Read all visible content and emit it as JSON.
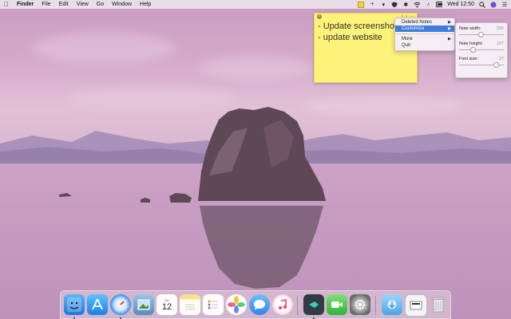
{
  "menubar": {
    "items": [
      "Finder",
      "File",
      "Edit",
      "View",
      "Go",
      "Window",
      "Help"
    ],
    "clock": "Wed 12:50"
  },
  "note": {
    "lines": [
      "- Update screenshots",
      "- update website"
    ]
  },
  "context_menu": {
    "items": [
      {
        "label": "Deleted Notes",
        "submenu": true
      },
      {
        "label": "Customize",
        "submenu": true,
        "selected": true
      },
      {
        "label": "More",
        "submenu": true
      },
      {
        "label": "Quit",
        "submenu": false
      }
    ]
  },
  "customize_panel": {
    "note_width": {
      "label": "Note width:",
      "value": "200",
      "fraction": 0.48
    },
    "note_height": {
      "label": "Note height:",
      "value": "107",
      "fraction": 0.3
    },
    "font_size": {
      "label": "Font size:",
      "value": "27",
      "fraction": 0.82
    }
  },
  "dock": {
    "apps": [
      "finder-icon",
      "app-store-icon",
      "safari-icon",
      "preview-icon",
      "calendar-icon",
      "notes-icon",
      "reminders-icon",
      "photos-icon",
      "messages-icon",
      "itunes-icon",
      "stickies-app-icon",
      "facetime-icon",
      "system-preferences-icon",
      "downloads-folder-icon",
      "document-stack-icon",
      "trash-icon"
    ],
    "calendar_day": "12",
    "calendar_month": "JUL",
    "colors": {
      "finder": "#2d8fe8",
      "appstore": "#2a8ff0",
      "safari": "#3b9ef0",
      "itunes": "#f0507a"
    }
  }
}
